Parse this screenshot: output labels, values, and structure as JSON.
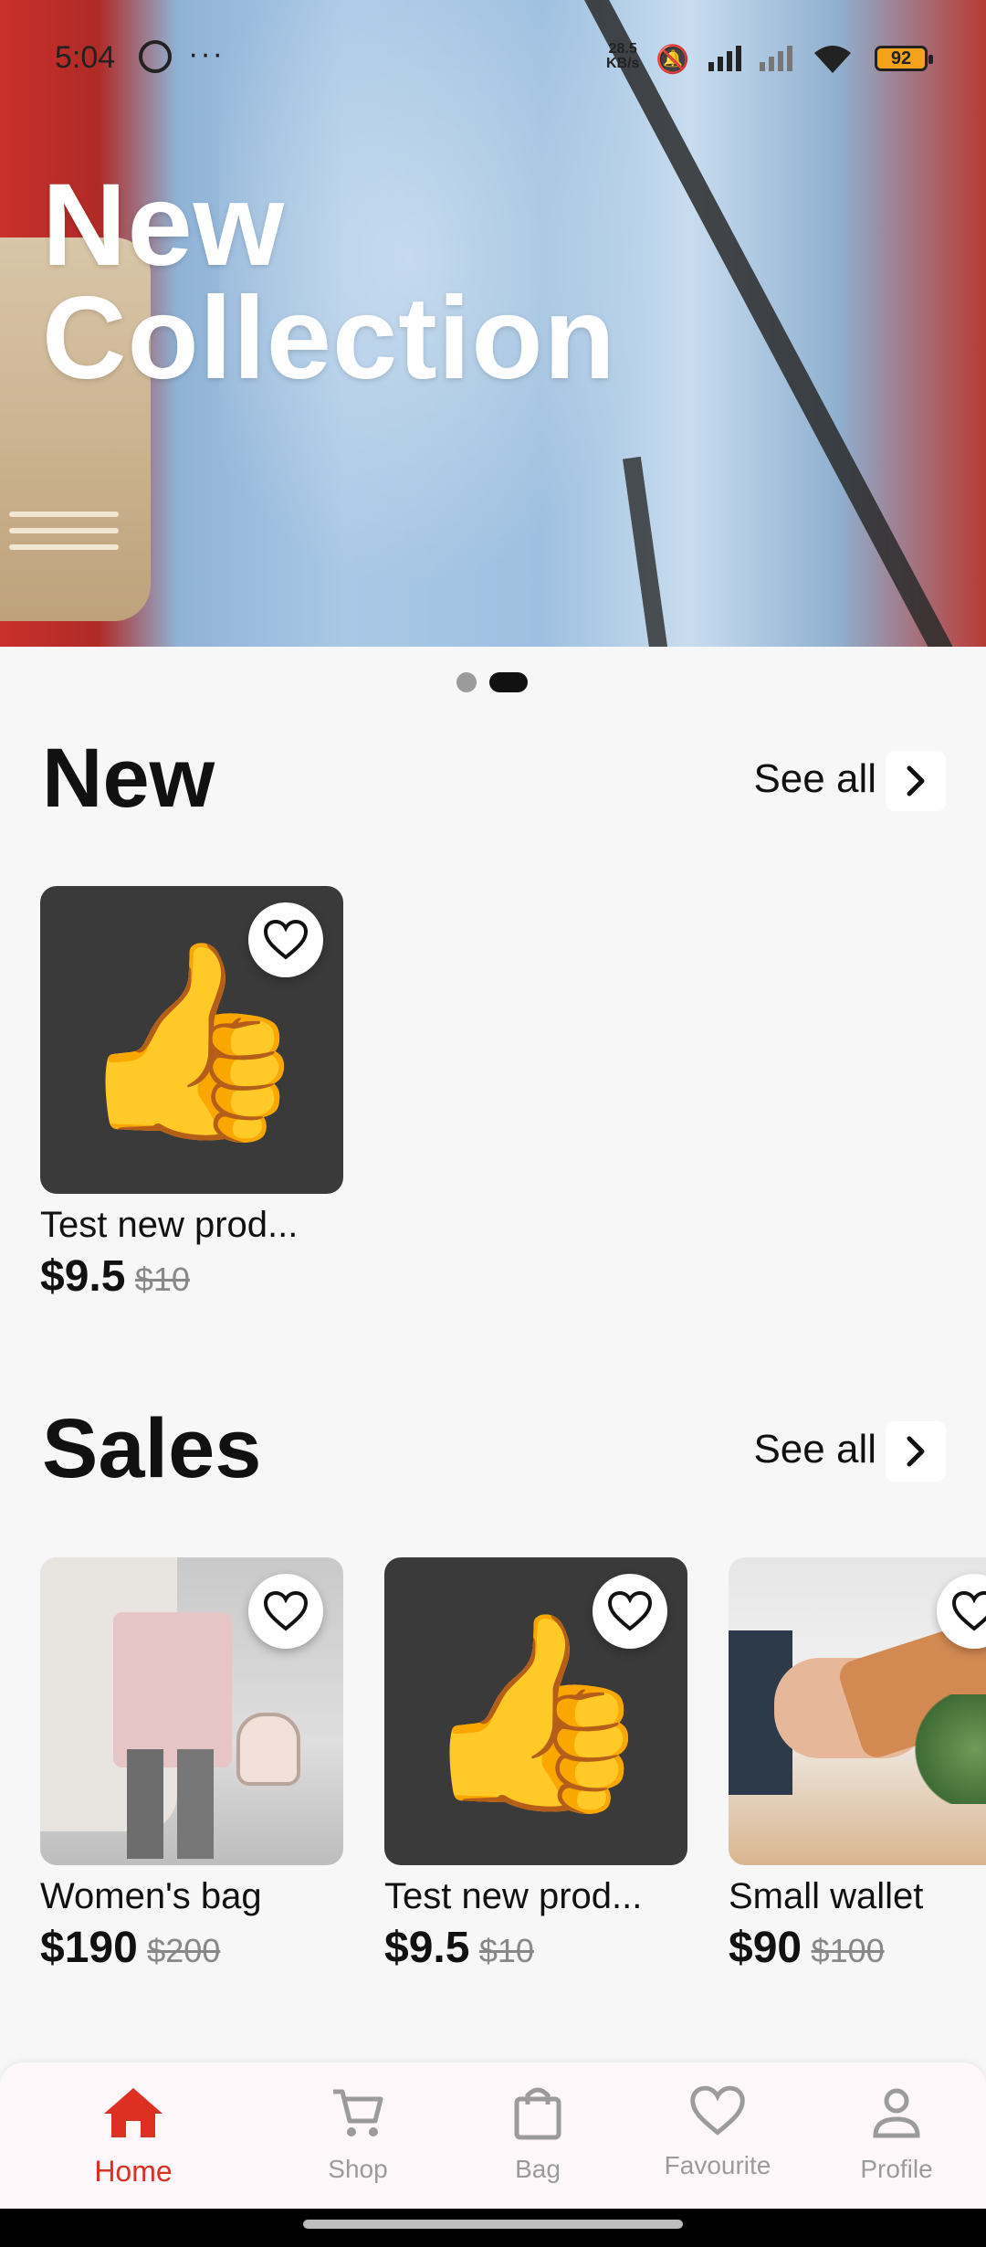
{
  "status_bar": {
    "time": "5:04",
    "dots": "···",
    "net_speed": "28.5",
    "net_unit": "KB/s",
    "battery": "92"
  },
  "hero": {
    "title_line1": "New",
    "title_line2": "Collection",
    "page_count": 2,
    "active_page": 2
  },
  "new_section": {
    "title": "New",
    "see_all": "See all",
    "products": [
      {
        "name": "Test new prod...",
        "price": "$9.5",
        "old_price": "$10",
        "image": "thumbs-up-emoji"
      }
    ]
  },
  "sales_section": {
    "title": "Sales",
    "see_all": "See all",
    "products": [
      {
        "name": "Women's bag",
        "price": "$190",
        "old_price": "$200",
        "image": "womens-bag-photo"
      },
      {
        "name": "Test new prod...",
        "price": "$9.5",
        "old_price": "$10",
        "image": "thumbs-up-emoji"
      },
      {
        "name": "Small wallet",
        "price": "$90",
        "old_price": "$100",
        "image": "small-wallet-photo"
      }
    ]
  },
  "bottom_nav": {
    "items": [
      {
        "label": "Home",
        "icon": "home-icon",
        "active": true
      },
      {
        "label": "Shop",
        "icon": "cart-icon",
        "active": false
      },
      {
        "label": "Bag",
        "icon": "bag-icon",
        "active": false
      },
      {
        "label": "Favourite",
        "icon": "heart-icon",
        "active": false
      },
      {
        "label": "Profile",
        "icon": "person-icon",
        "active": false
      }
    ]
  },
  "colors": {
    "accent": "#db3022",
    "background": "#f7f7f7",
    "inactive": "#9b9b9b"
  }
}
